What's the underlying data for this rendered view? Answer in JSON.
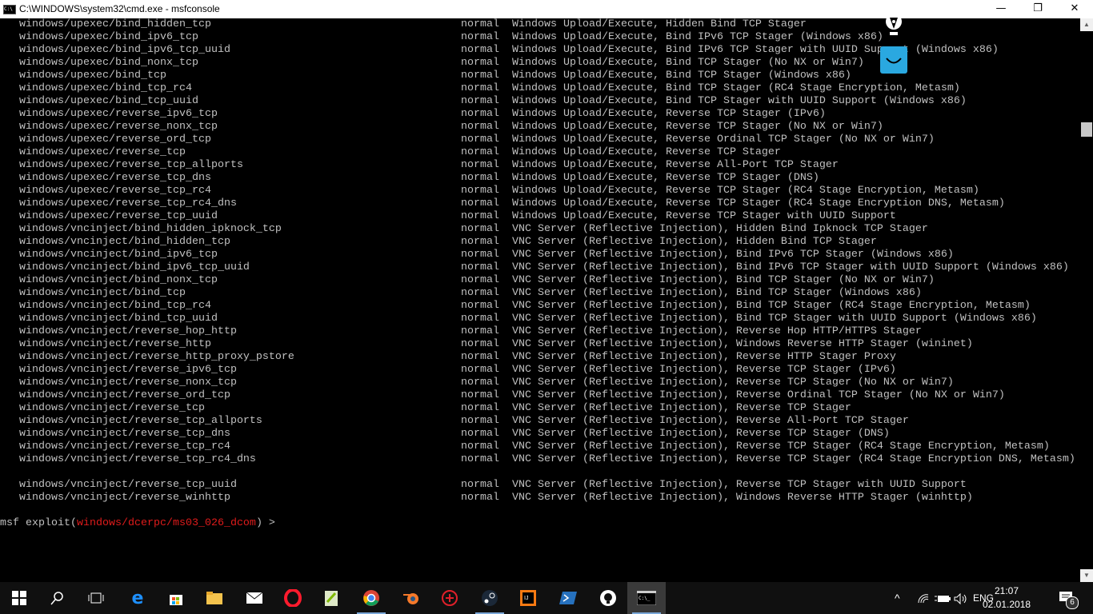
{
  "window": {
    "title": "C:\\WINDOWS\\system32\\cmd.exe - msfconsole",
    "minimize": "—",
    "maximize": "❐",
    "close": "✕"
  },
  "rows": [
    [
      "windows/upexec/bind_hidden_tcp",
      "normal",
      "Windows Upload/Execute, Hidden Bind TCP Stager"
    ],
    [
      "windows/upexec/bind_ipv6_tcp",
      "normal",
      "Windows Upload/Execute, Bind IPv6 TCP Stager (Windows x86)"
    ],
    [
      "windows/upexec/bind_ipv6_tcp_uuid",
      "normal",
      "Windows Upload/Execute, Bind IPv6 TCP Stager with UUID Support (Windows x86)"
    ],
    [
      "windows/upexec/bind_nonx_tcp",
      "normal",
      "Windows Upload/Execute, Bind TCP Stager (No NX or Win7)"
    ],
    [
      "windows/upexec/bind_tcp",
      "normal",
      "Windows Upload/Execute, Bind TCP Stager (Windows x86)"
    ],
    [
      "windows/upexec/bind_tcp_rc4",
      "normal",
      "Windows Upload/Execute, Bind TCP Stager (RC4 Stage Encryption, Metasm)"
    ],
    [
      "windows/upexec/bind_tcp_uuid",
      "normal",
      "Windows Upload/Execute, Bind TCP Stager with UUID Support (Windows x86)"
    ],
    [
      "windows/upexec/reverse_ipv6_tcp",
      "normal",
      "Windows Upload/Execute, Reverse TCP Stager (IPv6)"
    ],
    [
      "windows/upexec/reverse_nonx_tcp",
      "normal",
      "Windows Upload/Execute, Reverse TCP Stager (No NX or Win7)"
    ],
    [
      "windows/upexec/reverse_ord_tcp",
      "normal",
      "Windows Upload/Execute, Reverse Ordinal TCP Stager (No NX or Win7)"
    ],
    [
      "windows/upexec/reverse_tcp",
      "normal",
      "Windows Upload/Execute, Reverse TCP Stager"
    ],
    [
      "windows/upexec/reverse_tcp_allports",
      "normal",
      "Windows Upload/Execute, Reverse All-Port TCP Stager"
    ],
    [
      "windows/upexec/reverse_tcp_dns",
      "normal",
      "Windows Upload/Execute, Reverse TCP Stager (DNS)"
    ],
    [
      "windows/upexec/reverse_tcp_rc4",
      "normal",
      "Windows Upload/Execute, Reverse TCP Stager (RC4 Stage Encryption, Metasm)"
    ],
    [
      "windows/upexec/reverse_tcp_rc4_dns",
      "normal",
      "Windows Upload/Execute, Reverse TCP Stager (RC4 Stage Encryption DNS, Metasm)"
    ],
    [
      "windows/upexec/reverse_tcp_uuid",
      "normal",
      "Windows Upload/Execute, Reverse TCP Stager with UUID Support"
    ],
    [
      "windows/vncinject/bind_hidden_ipknock_tcp",
      "normal",
      "VNC Server (Reflective Injection), Hidden Bind Ipknock TCP Stager"
    ],
    [
      "windows/vncinject/bind_hidden_tcp",
      "normal",
      "VNC Server (Reflective Injection), Hidden Bind TCP Stager"
    ],
    [
      "windows/vncinject/bind_ipv6_tcp",
      "normal",
      "VNC Server (Reflective Injection), Bind IPv6 TCP Stager (Windows x86)"
    ],
    [
      "windows/vncinject/bind_ipv6_tcp_uuid",
      "normal",
      "VNC Server (Reflective Injection), Bind IPv6 TCP Stager with UUID Support (Windows x86)"
    ],
    [
      "windows/vncinject/bind_nonx_tcp",
      "normal",
      "VNC Server (Reflective Injection), Bind TCP Stager (No NX or Win7)"
    ],
    [
      "windows/vncinject/bind_tcp",
      "normal",
      "VNC Server (Reflective Injection), Bind TCP Stager (Windows x86)"
    ],
    [
      "windows/vncinject/bind_tcp_rc4",
      "normal",
      "VNC Server (Reflective Injection), Bind TCP Stager (RC4 Stage Encryption, Metasm)"
    ],
    [
      "windows/vncinject/bind_tcp_uuid",
      "normal",
      "VNC Server (Reflective Injection), Bind TCP Stager with UUID Support (Windows x86)"
    ],
    [
      "windows/vncinject/reverse_hop_http",
      "normal",
      "VNC Server (Reflective Injection), Reverse Hop HTTP/HTTPS Stager"
    ],
    [
      "windows/vncinject/reverse_http",
      "normal",
      "VNC Server (Reflective Injection), Windows Reverse HTTP Stager (wininet)"
    ],
    [
      "windows/vncinject/reverse_http_proxy_pstore",
      "normal",
      "VNC Server (Reflective Injection), Reverse HTTP Stager Proxy"
    ],
    [
      "windows/vncinject/reverse_ipv6_tcp",
      "normal",
      "VNC Server (Reflective Injection), Reverse TCP Stager (IPv6)"
    ],
    [
      "windows/vncinject/reverse_nonx_tcp",
      "normal",
      "VNC Server (Reflective Injection), Reverse TCP Stager (No NX or Win7)"
    ],
    [
      "windows/vncinject/reverse_ord_tcp",
      "normal",
      "VNC Server (Reflective Injection), Reverse Ordinal TCP Stager (No NX or Win7)"
    ],
    [
      "windows/vncinject/reverse_tcp",
      "normal",
      "VNC Server (Reflective Injection), Reverse TCP Stager"
    ],
    [
      "windows/vncinject/reverse_tcp_allports",
      "normal",
      "VNC Server (Reflective Injection), Reverse All-Port TCP Stager"
    ],
    [
      "windows/vncinject/reverse_tcp_dns",
      "normal",
      "VNC Server (Reflective Injection), Reverse TCP Stager (DNS)"
    ],
    [
      "windows/vncinject/reverse_tcp_rc4",
      "normal",
      "VNC Server (Reflective Injection), Reverse TCP Stager (RC4 Stage Encryption, Metasm)"
    ],
    [
      "windows/vncinject/reverse_tcp_rc4_dns",
      "normal",
      "VNC Server (Reflective Injection), Reverse TCP Stager (RC4 Stage Encryption DNS, Metasm)"
    ],
    null,
    [
      "windows/vncinject/reverse_tcp_uuid",
      "normal",
      "VNC Server (Reflective Injection), Reverse TCP Stager with UUID Support"
    ],
    [
      "windows/vncinject/reverse_winhttp",
      "normal",
      "VNC Server (Reflective Injection), Windows Reverse HTTP Stager (winhttp)"
    ]
  ],
  "prompt": {
    "prefix": "msf exploit(",
    "module": "windows/dcerpc/ms03_026_dcom",
    "suffix": ") >"
  },
  "taskbar": {
    "apps": [
      "start",
      "search",
      "task-view",
      "edge",
      "store",
      "file-explorer",
      "mail",
      "opera",
      "notepad-plus",
      "chrome",
      "blender",
      "app-red",
      "steam",
      "intellij",
      "powershell",
      "app-tor",
      "cmd"
    ],
    "tray": {
      "language": "ENG",
      "time": "21:07",
      "date": "02.01.2018",
      "notifications": "6"
    }
  }
}
